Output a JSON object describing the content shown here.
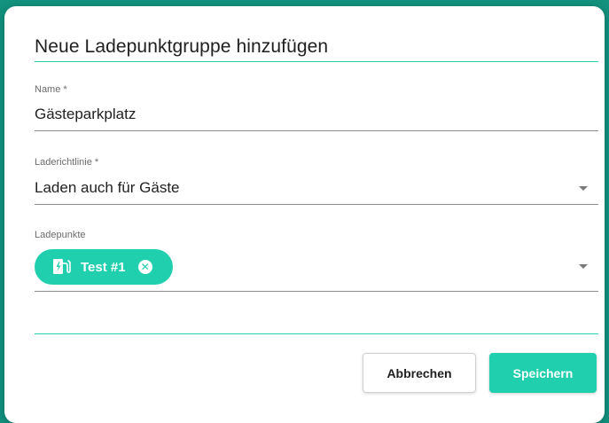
{
  "dialog": {
    "title": "Neue Ladepunktgruppe hinzufügen"
  },
  "fields": {
    "name": {
      "label": "Name *",
      "value": "Gästeparkplatz"
    },
    "policy": {
      "label": "Laderichtlinie *",
      "value": "Laden auch für Gäste"
    },
    "chargepoints": {
      "label": "Ladepunkte",
      "chips": [
        {
          "label": "Test #1",
          "icon": "ev-charger-icon"
        }
      ]
    }
  },
  "actions": {
    "cancel_label": "Abbrechen",
    "save_label": "Speichern"
  },
  "colors": {
    "accent": "#20cfae",
    "background": "#12927f"
  }
}
